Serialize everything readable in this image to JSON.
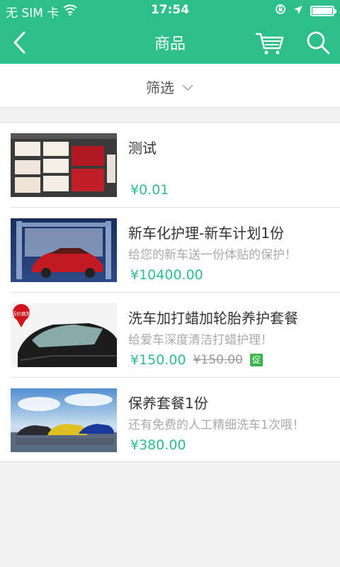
{
  "status_bar": {
    "carrier": "无 SIM 卡",
    "time": "17:54",
    "icons": [
      "wifi-icon",
      "rotation-lock-icon",
      "location-arrow-icon",
      "battery-icon"
    ]
  },
  "nav": {
    "title": "商品",
    "icons": [
      "back-chevron-icon",
      "cart-icon",
      "search-icon"
    ]
  },
  "filter": {
    "label": "筛选",
    "icon": "chevron-down-icon"
  },
  "products": [
    {
      "name": "测试",
      "description": "",
      "price": "¥0.01",
      "original_price": "",
      "promo_badge": "",
      "image": "business-card-mockup-thumbnail"
    },
    {
      "name": "新车化护理-新车计划1份",
      "description": "给您的新车送一份体贴的保护！",
      "price": "¥10400.00",
      "original_price": "",
      "promo_badge": "",
      "image": "red-car-wash-thumbnail"
    },
    {
      "name": "洗车加打蜡加轮胎养护套餐",
      "description": "给爱车深度清洁打蜡护理！",
      "price": "¥150.00",
      "original_price": "¥150.00",
      "promo_badge": "促",
      "image": "black-car-low-price-thumbnail",
      "image_tag": "低价疯抢"
    },
    {
      "name": "保养套餐1份",
      "description": "还有免费的人工精细洗车1次哦！",
      "price": "¥380.00",
      "original_price": "",
      "promo_badge": "",
      "image": "three-cars-sky-thumbnail"
    }
  ],
  "colors": {
    "accent": "#2dbf8a",
    "promo": "#3ab34a",
    "background": "#f2f2f2"
  }
}
